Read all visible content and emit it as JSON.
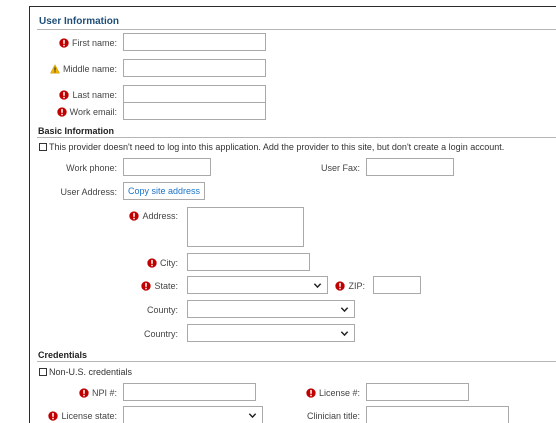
{
  "user_info": {
    "title": "User Information",
    "first_name_label": "First name:",
    "middle_name_label": "Middle name:",
    "last_name_label": "Last name:",
    "work_email_label": "Work email:"
  },
  "basic_info": {
    "title": "Basic Information",
    "no_login_text": "This provider doesn't need to log into this application. Add the provider to this site, but don't create a login account.",
    "work_phone_label": "Work phone:",
    "user_fax_label": "User Fax:",
    "user_address_label": "User Address:",
    "copy_site_address_label": "Copy site address",
    "address_label": "Address:",
    "city_label": "City:",
    "state_label": "State:",
    "zip_label": "ZIP:",
    "county_label": "County:",
    "country_label": "Country:"
  },
  "credentials": {
    "title": "Credentials",
    "non_us_text": "Non-U.S. credentials",
    "npi_label": "NPI #:",
    "license_label": "License #:",
    "license_state_label": "License state:",
    "clinician_title_label": "Clinician title:"
  },
  "icons": {
    "required": "required-icon",
    "warning": "warning-icon"
  },
  "colors": {
    "required_red": "#c00000",
    "warning_yellow": "#f2b600",
    "section_blue": "#1f4e79",
    "link_blue": "#1a73c7"
  }
}
